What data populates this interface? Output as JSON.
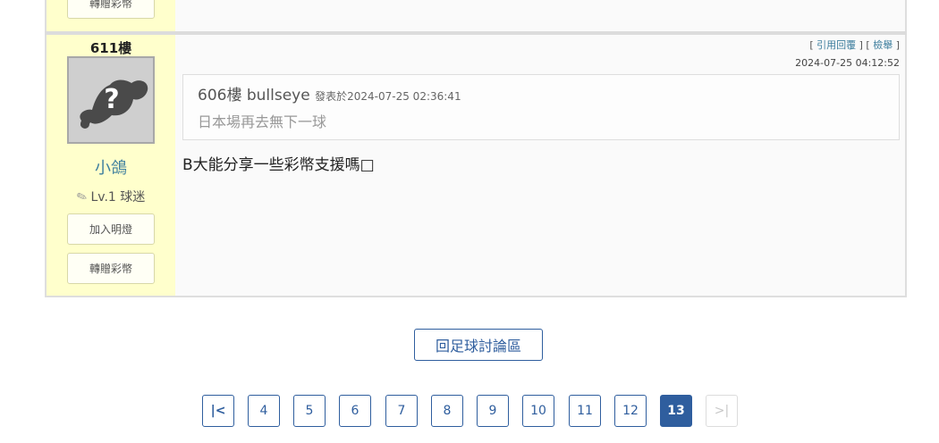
{
  "previous_post": {
    "gift_label": "轉贈彩幣"
  },
  "post": {
    "floor": "611樓",
    "username": "小鴿",
    "level": "Lv.1",
    "level_title": "球迷",
    "follow_label": "加入明燈",
    "gift_label": "轉贈彩幣",
    "actions": {
      "quote_reply": "引用回覆",
      "report": "檢舉"
    },
    "timestamp": "2024-07-25 04:12:52",
    "quote": {
      "floor": "606樓",
      "author": "bullseye",
      "meta": "發表於2024-07-25 02:36:41",
      "text": "日本場再去無下一球"
    },
    "content": "B大能分享一些彩幣支援嗎□"
  },
  "back_button": "回足球討論區",
  "pagination": {
    "first_icon": "first-page-icon",
    "last_icon": "last-page-icon",
    "pages": [
      "4",
      "5",
      "6",
      "7",
      "8",
      "9",
      "10",
      "11",
      "12",
      "13"
    ],
    "current": "13"
  },
  "colors": {
    "user_bg": "#ffffcc",
    "accent": "#2f5e9e",
    "username": "#3d7e9e"
  }
}
